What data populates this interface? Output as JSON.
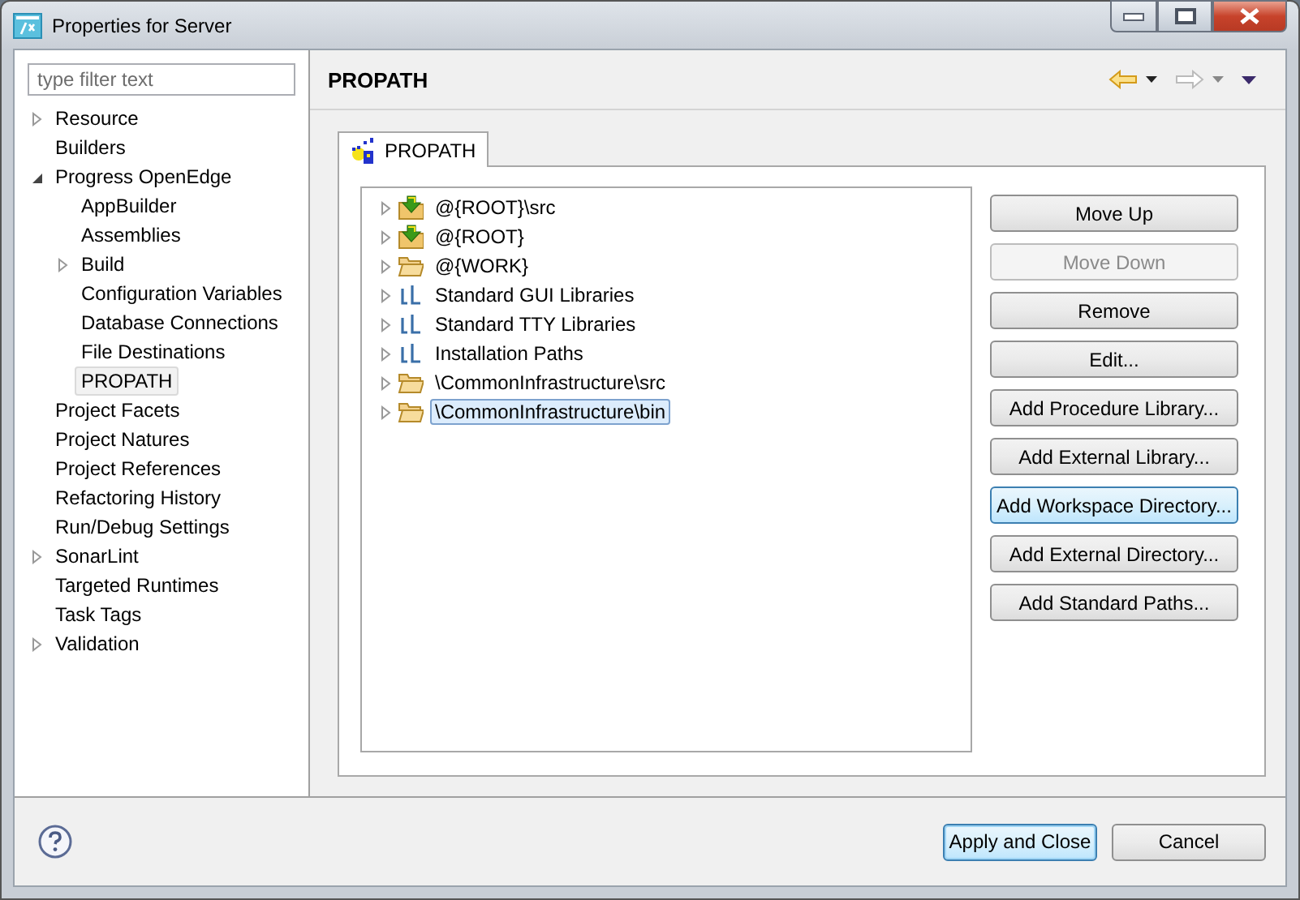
{
  "window": {
    "title": "Properties for Server"
  },
  "filter": {
    "placeholder": "type filter text"
  },
  "sidebar": {
    "items": [
      {
        "label": "Resource",
        "expanded": false,
        "selected": false
      },
      {
        "label": "Builders",
        "selected": false
      },
      {
        "label": "Progress OpenEdge",
        "expanded": true,
        "selected": false,
        "children": [
          {
            "label": "AppBuilder",
            "selected": false
          },
          {
            "label": "Assemblies",
            "selected": false
          },
          {
            "label": "Build",
            "expanded": false,
            "selected": false
          },
          {
            "label": "Configuration Variables",
            "selected": false
          },
          {
            "label": "Database Connections",
            "selected": false
          },
          {
            "label": "File Destinations",
            "selected": false
          },
          {
            "label": "PROPATH",
            "selected": true
          }
        ]
      },
      {
        "label": "Project Facets",
        "selected": false
      },
      {
        "label": "Project Natures",
        "selected": false
      },
      {
        "label": "Project References",
        "selected": false
      },
      {
        "label": "Refactoring History",
        "selected": false
      },
      {
        "label": "Run/Debug Settings",
        "selected": false
      },
      {
        "label": "SonarLint",
        "expanded": false,
        "selected": false
      },
      {
        "label": "Targeted Runtimes",
        "selected": false
      },
      {
        "label": "Task Tags",
        "selected": false
      },
      {
        "label": "Validation",
        "expanded": false,
        "selected": false
      }
    ]
  },
  "page": {
    "title": "PROPATH",
    "tabs": [
      {
        "label": "PROPATH",
        "selected": true
      }
    ],
    "entries": [
      {
        "kind": "root",
        "label": "@{ROOT}\\src",
        "selected": false
      },
      {
        "kind": "root",
        "label": "@{ROOT}",
        "selected": false
      },
      {
        "kind": "folder",
        "label": "@{WORK}",
        "selected": false
      },
      {
        "kind": "library",
        "label": "Standard GUI Libraries",
        "selected": false
      },
      {
        "kind": "library",
        "label": "Standard TTY Libraries",
        "selected": false
      },
      {
        "kind": "library",
        "label": "Installation Paths",
        "selected": false
      },
      {
        "kind": "folder",
        "label": "\\CommonInfrastructure\\src",
        "selected": false
      },
      {
        "kind": "folder",
        "label": "\\CommonInfrastructure\\bin",
        "selected": true
      }
    ],
    "buttons": [
      {
        "label": "Move Up",
        "disabled": false,
        "focused": false
      },
      {
        "label": "Move Down",
        "disabled": true,
        "focused": false
      },
      {
        "label": "Remove",
        "disabled": false,
        "focused": false
      },
      {
        "label": "Edit...",
        "disabled": false,
        "focused": false
      },
      {
        "label": "Add Procedure Library...",
        "disabled": false,
        "focused": false
      },
      {
        "label": "Add External Library...",
        "disabled": false,
        "focused": false
      },
      {
        "label": "Add Workspace Directory...",
        "disabled": false,
        "focused": true
      },
      {
        "label": "Add External Directory...",
        "disabled": false,
        "focused": false
      },
      {
        "label": "Add Standard Paths...",
        "disabled": false,
        "focused": false
      }
    ]
  },
  "footer": {
    "buttons": [
      {
        "label": "Apply and Close",
        "default": true
      },
      {
        "label": "Cancel",
        "default": false
      }
    ]
  }
}
